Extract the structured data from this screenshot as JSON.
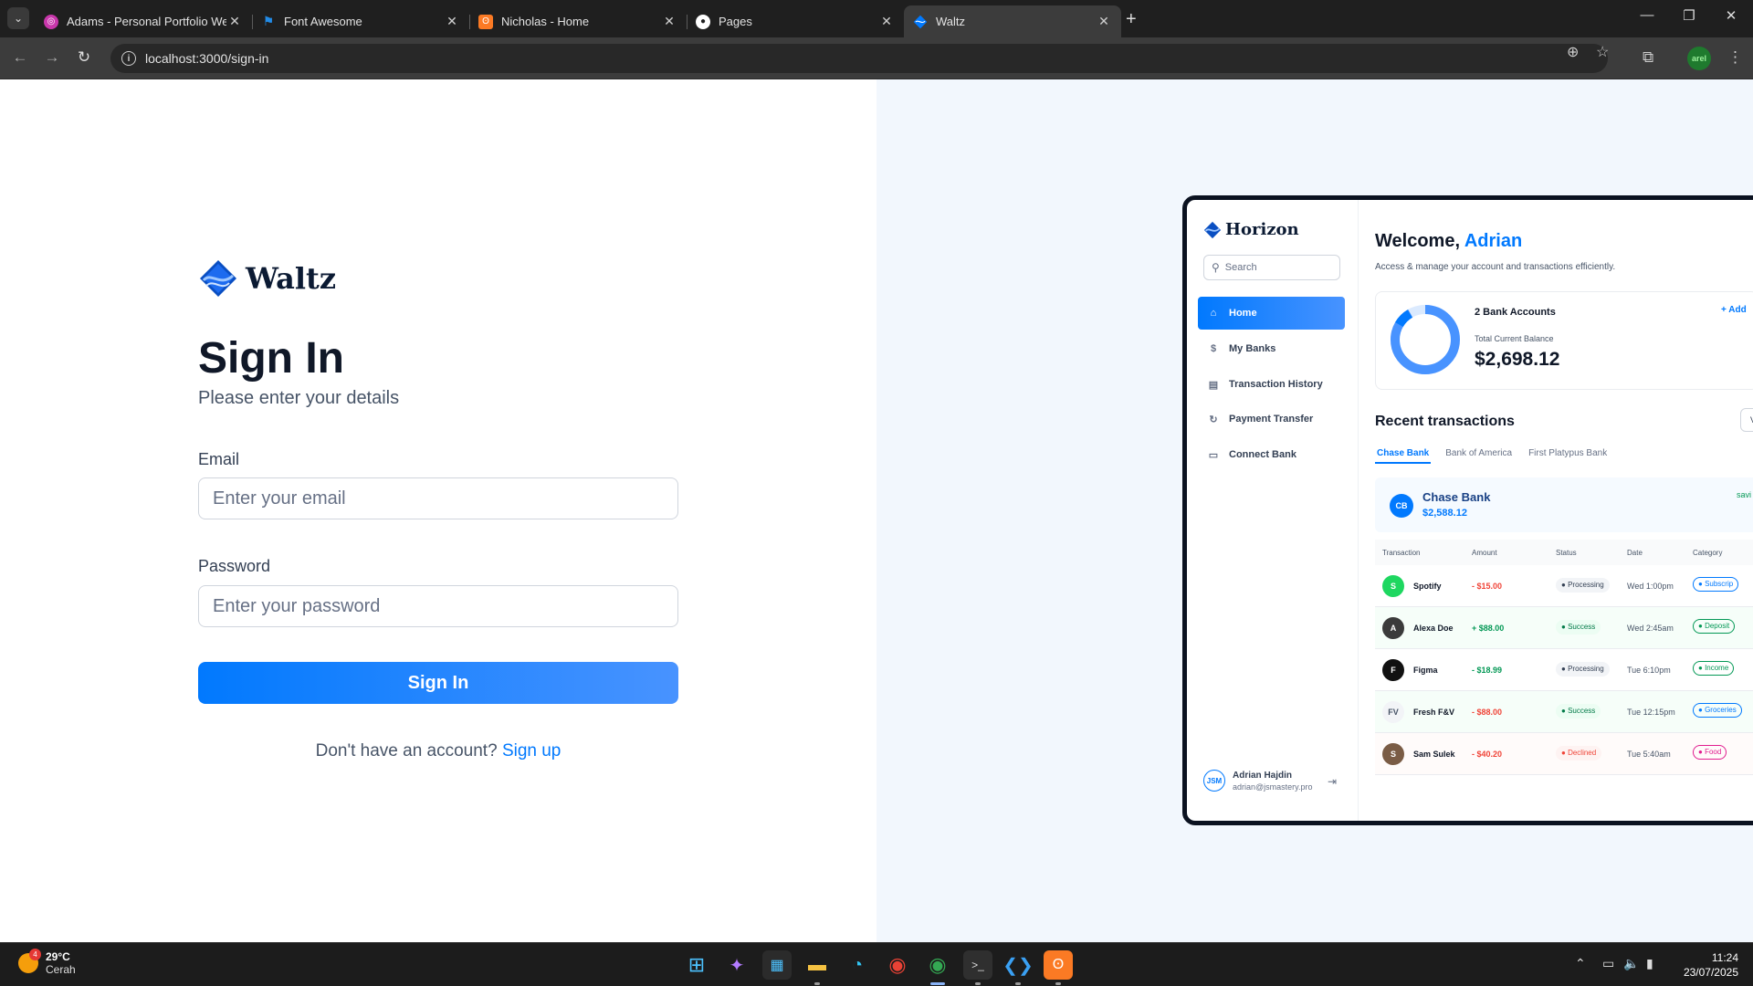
{
  "browser": {
    "tabs": [
      {
        "title": "Adams - Personal Portfolio Web",
        "favicon": "portfolio-icon",
        "color": "#c837ab"
      },
      {
        "title": "Font Awesome",
        "favicon": "flag-icon",
        "color": "#228be6"
      },
      {
        "title": "Nicholas - Home",
        "favicon": "xampp-icon",
        "color": "#fb7a24"
      },
      {
        "title": "Pages",
        "favicon": "github-icon",
        "color": "#ffffff"
      },
      {
        "title": "Waltz",
        "favicon": "waltz-logo-icon",
        "color": "#0179fe",
        "active": true
      }
    ],
    "url": "localhost:3000/sign-in",
    "profile_label": "arel"
  },
  "auth": {
    "brand": "Waltz",
    "title": "Sign In",
    "subtitle": "Please enter your details",
    "email_label": "Email",
    "email_placeholder": "Enter your email",
    "password_label": "Password",
    "password_placeholder": "Enter your password",
    "submit_label": "Sign In",
    "footer_text": "Don't have an account?",
    "footer_link": "Sign up",
    "accent": "#0179fe"
  },
  "preview": {
    "brand": "Horizon",
    "search_placeholder": "Search",
    "nav": [
      {
        "label": "Home",
        "icon": "home-icon",
        "active": true
      },
      {
        "label": "My Banks",
        "icon": "dollar-icon"
      },
      {
        "label": "Transaction History",
        "icon": "receipt-icon"
      },
      {
        "label": "Payment Transfer",
        "icon": "transfer-icon"
      },
      {
        "label": "Connect Bank",
        "icon": "connect-bank-icon"
      }
    ],
    "user": {
      "initials": "JSM",
      "name": "Adrian Hajdin",
      "email": "adrian@jsmastery.pro"
    },
    "welcome_prefix": "Welcome,",
    "welcome_name": "Adrian",
    "description": "Access & manage your account and transactions efficiently.",
    "accounts_count": "2 Bank Accounts",
    "balance_label": "Total Current Balance",
    "balance": "$2,698.12",
    "add_bank": "+ Add",
    "recent_title": "Recent transactions",
    "view_all": "Vi",
    "bank_tabs": [
      "Chase Bank",
      "Bank of America",
      "First Platypus Bank"
    ],
    "bank": {
      "initials": "CB",
      "name": "Chase Bank",
      "amount": "$2,588.12",
      "type": "savi"
    },
    "table_headers": [
      "Transaction",
      "Amount",
      "Status",
      "Date",
      "Category"
    ],
    "transactions": [
      {
        "name": "Spotify",
        "amount": "- $15.00",
        "status": "Processing",
        "date": "Wed 1:00pm",
        "category": "Subscrip",
        "avatar": "S",
        "avatar_color": "#1ed760",
        "amount_sign": "neg",
        "status_kind": "processing",
        "cat_color": "#0179fe"
      },
      {
        "name": "Alexa Doe",
        "amount": "+ $88.00",
        "status": "Success",
        "date": "Wed 2:45am",
        "category": "Deposit",
        "avatar": "A",
        "avatar_color": "#3b3b3b",
        "amount_sign": "pos",
        "status_kind": "success",
        "cat_color": "#039855"
      },
      {
        "name": "Figma",
        "amount": "- $18.99",
        "status": "Processing",
        "date": "Tue 6:10pm",
        "category": "Income",
        "avatar": "F",
        "avatar_color": "#111111",
        "amount_sign": "pos",
        "status_kind": "processing",
        "cat_color": "#039855"
      },
      {
        "name": "Fresh F&V",
        "amount": "- $88.00",
        "status": "Success",
        "date": "Tue 12:15pm",
        "category": "Groceries",
        "avatar": "FV",
        "avatar_color": "#f2f4f7",
        "amount_sign": "neg",
        "status_kind": "success",
        "cat_color": "#0179fe"
      },
      {
        "name": "Sam Sulek",
        "amount": "- $40.20",
        "status": "Declined",
        "date": "Tue 5:40am",
        "category": "Food",
        "avatar": "S",
        "avatar_color": "#7a5c45",
        "amount_sign": "neg",
        "status_kind": "declined",
        "cat_color": "#e11d8f"
      }
    ]
  },
  "taskbar": {
    "temp": "29°C",
    "weather": "Cerah",
    "weather_badge": "4",
    "time": "11:24",
    "date": "23/07/2025"
  }
}
